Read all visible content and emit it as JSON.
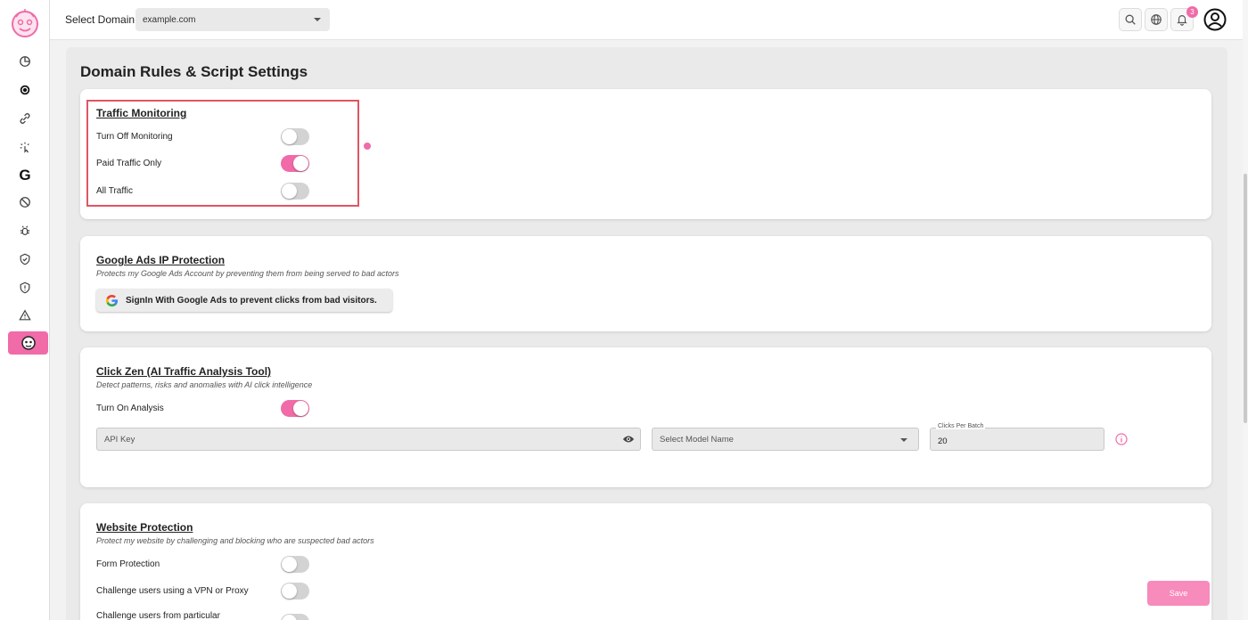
{
  "topbar": {
    "domain_label": "Select Domain",
    "domain_value": "example.com",
    "notification_count": "3"
  },
  "page": {
    "title": "Domain Rules & Script Settings"
  },
  "traffic_monitoring": {
    "title": "Traffic Monitoring",
    "rows": [
      {
        "label": "Turn Off Monitoring",
        "on": false
      },
      {
        "label": "Paid Traffic Only",
        "on": true
      },
      {
        "label": "All Traffic",
        "on": false
      }
    ]
  },
  "google_ads": {
    "title": "Google Ads IP Protection",
    "subtitle": "Protects my Google Ads Account by preventing them from being served to bad actors",
    "button_label": "SignIn With Google Ads to prevent clicks from bad visitors."
  },
  "click_zen": {
    "title": "Click Zen (AI Traffic Analysis Tool)",
    "subtitle": "Detect patterns, risks and anomalies with AI click intelligence",
    "analysis_label": "Turn On Analysis",
    "analysis_on": true,
    "api_key_placeholder": "API Key",
    "model_placeholder": "Select Model Name",
    "clicks_legend": "Clicks Per Batch",
    "clicks_value": "20"
  },
  "website_protection": {
    "title": "Website Protection",
    "subtitle": "Protect my website by challenging and blocking who are suspected bad actors",
    "rows": [
      {
        "label": "Form Protection",
        "on": false
      },
      {
        "label": "Challenge users using a VPN or Proxy",
        "on": false
      },
      {
        "label": "Challenge users from particular",
        "on": false
      }
    ]
  },
  "actions": {
    "save_label": "Save"
  },
  "colors": {
    "accent": "#f06ba8",
    "highlight": "#e05563"
  }
}
